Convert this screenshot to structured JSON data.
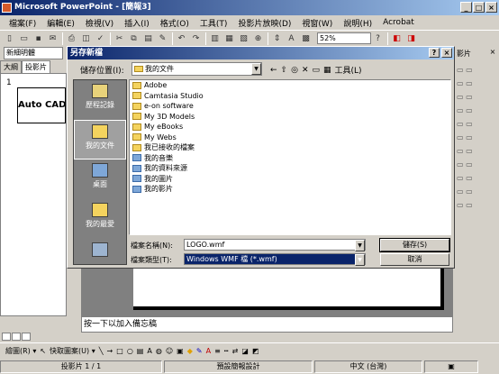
{
  "app": {
    "title": "Microsoft PowerPoint - [簡報3]",
    "window_buttons": [
      "_",
      "□",
      "×"
    ]
  },
  "menu": [
    "檔案(F)",
    "編輯(E)",
    "檢視(V)",
    "插入(I)",
    "格式(O)",
    "工具(T)",
    "投影片放映(D)",
    "視窗(W)",
    "說明(H)",
    "Acrobat"
  ],
  "toolbar": {
    "zoom": "52%",
    "font": "新細明體"
  },
  "side_tabs": [
    "大綱",
    "投影片"
  ],
  "thumbnail": {
    "number": "1",
    "text": "Auto CAD 實用技"
  },
  "right_pane": {
    "label": "影片",
    "close": "×",
    "items": [
      "",
      "",
      "",
      "",
      "",
      "",
      "",
      "",
      "",
      "",
      ""
    ]
  },
  "dialog": {
    "title": "另存新檔",
    "help": "?",
    "close": "×",
    "location_label": "儲存位置(I):",
    "location_value": "我的文件",
    "tools_label": "工具(L)",
    "places": [
      "歷程記錄",
      "我的文件",
      "桌面",
      "我的最愛",
      ""
    ],
    "files": [
      "Adobe",
      "Camtasia Studio",
      "e-on software",
      "My 3D Models",
      "My eBooks",
      "My Webs",
      "我已接收的檔案",
      "我的音樂",
      "我的資料來源",
      "我的圖片",
      "我的影片"
    ],
    "filename_label": "檔案名稱(N):",
    "filename_value": "LOGO.wmf",
    "filetype_label": "檔案類型(T):",
    "filetype_value": "Windows WMF 檔 (*.wmf)",
    "save_label": "儲存(S)",
    "cancel_label": "取消"
  },
  "notes": "按一下以加入備忘稿",
  "draw_toolbar": {
    "draw": "繪圖(R) ▾",
    "autoshapes": "快取圖案(U) ▾"
  },
  "status": {
    "slide": "投影片 1 / 1",
    "design": "預設簡報設計",
    "language": "中文 (台灣)"
  }
}
